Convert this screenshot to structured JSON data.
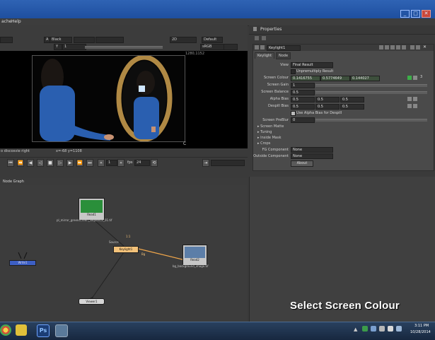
{
  "menubar": {
    "items": [
      "ache",
      "Help"
    ]
  },
  "viewer_toolbar": {
    "channel_a": "A",
    "channel_a_value": "Black",
    "display_mode": "2D",
    "lut": "Default",
    "color_space": "sRGB",
    "frame_value": "1",
    "top_value": "Y"
  },
  "viewer": {
    "status_left": "o discosvie right",
    "status_coords": "x=-68 y=1108",
    "corner_label": "C",
    "frame_corner_label": "1280,1152"
  },
  "transport": {
    "frame": "1",
    "fps_label": "fps",
    "fps_value": "24"
  },
  "properties": {
    "title": "Properties",
    "node_name": "Keylight1",
    "tabs": [
      "Keylight",
      "Node"
    ],
    "view_label": "View",
    "view_value": "Final Result",
    "unpremult_label": "Unpremultiply Result",
    "screen_colour_label": "Screen Colour",
    "screen_colour_r": "0.1416755",
    "screen_colour_g": "0.5774649",
    "screen_colour_b": "0.144027",
    "screen_gain_label": "Screen Gain",
    "screen_gain_value": "1",
    "screen_balance_label": "Screen Balance",
    "screen_balance_value": "0.5",
    "alpha_bias_label": "Alpha Bias",
    "alpha_bias_r": "0.5",
    "alpha_bias_g": "0.5",
    "alpha_bias_b": "0.5",
    "despill_bias_label": "Despill Bias",
    "despill_bias_r": "0.5",
    "despill_bias_g": "0.5",
    "despill_bias_b": "0.5",
    "use_alpha_bias_label": "Use Alpha Bias for Despill",
    "screen_prematte_label": "Screen PreBlur",
    "screen_prematte_value": "0",
    "sections": [
      "Screen Matte",
      "Tuning",
      "Inside Mask",
      "Crops"
    ],
    "fg_component_label": "FG Component",
    "fg_component_value": "None",
    "outside_component_label": "Outside Component",
    "outside_component_value": "None",
    "about_button": "About"
  },
  "node_graph": {
    "tab": "Node Graph",
    "nodes": {
      "read1": "Read1",
      "read1_file": "pl_mirror_greenscreen_sequence_01.tif",
      "keylight": "Keylight1",
      "read2": "Read2",
      "read2_file": "bg_background_image.tif",
      "viewer": "Viewer1",
      "left_node": "Write1",
      "source_label": "Source",
      "bg_label": "Bg",
      "ref_label": "1:1"
    }
  },
  "overlay": {
    "caption": "Select Screen Colour"
  },
  "taskbar": {
    "time": "3:11 PM",
    "date": "10/28/2014"
  },
  "colors": {
    "accent_orange": "#f3c27a",
    "title_blue": "#2f63b4",
    "taskbar": "#1d324e"
  }
}
